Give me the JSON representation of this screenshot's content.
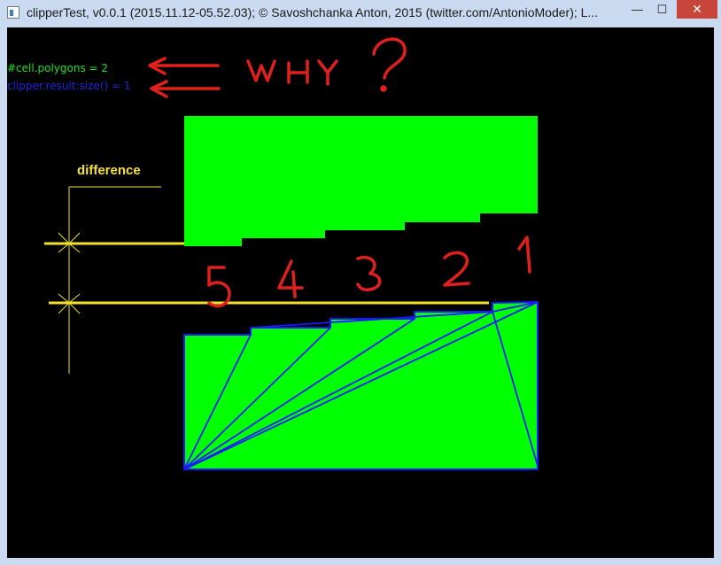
{
  "window": {
    "title": "clipperTest, v0.0.1 (2015.11.12-05.52.03); © Savoshchanka Anton, 2015 (twitter.com/AntonioModer); L...",
    "controls": {
      "minimize": "—",
      "maximize": "☐",
      "close": "✕"
    }
  },
  "canvas": {
    "stats": {
      "cell_polygons": "#cell.polygons = 2",
      "clipper_result": "clipper.result:size() = 1"
    },
    "annotation": "WHY?",
    "difference_label": "difference",
    "step_numbers": [
      "5",
      "4",
      "3",
      "2",
      "1"
    ]
  },
  "colors": {
    "background": "#000000",
    "fill": "#00ff00",
    "outline": "#1a1aff",
    "marker": "#f2e22a",
    "annotation": "#e0201c"
  }
}
